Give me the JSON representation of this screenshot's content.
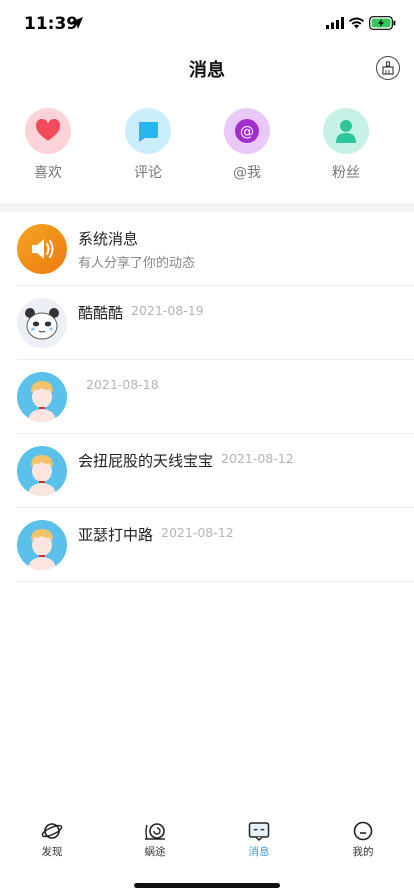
{
  "status_bar": {
    "time": "11:39"
  },
  "header": {
    "title": "消息"
  },
  "categories": [
    {
      "label": "喜欢",
      "icon": "heart-icon",
      "color": "#f24b5c"
    },
    {
      "label": "评论",
      "icon": "comment-icon",
      "color": "#27b6f0"
    },
    {
      "label": "@我",
      "icon": "at-icon",
      "color": "#a12fd0"
    },
    {
      "label": "粉丝",
      "icon": "fan-icon",
      "color": "#2ec79c"
    }
  ],
  "messages": [
    {
      "name": "系统消息",
      "subtitle": "有人分享了你的动态",
      "date": "",
      "avatar": "speaker-icon"
    },
    {
      "name": "酷酷酷",
      "subtitle": "",
      "date": "2021-08-19",
      "avatar": "panda-avatar"
    },
    {
      "name": "",
      "subtitle": "",
      "date": "2021-08-18",
      "avatar": "user-avatar"
    },
    {
      "name": "会扭屁股的天线宝宝",
      "subtitle": "",
      "date": "2021-08-12",
      "avatar": "user-avatar"
    },
    {
      "name": "亚瑟打中路",
      "subtitle": "",
      "date": "2021-08-12",
      "avatar": "user-avatar"
    }
  ],
  "tabs": [
    {
      "label": "发现",
      "icon": "planet-icon",
      "active": false
    },
    {
      "label": "蜗途",
      "icon": "snail-icon",
      "active": false
    },
    {
      "label": "消息",
      "icon": "message-icon",
      "active": true
    },
    {
      "label": "我的",
      "icon": "profile-icon",
      "active": false
    }
  ],
  "colors": {
    "accent": "#3a9ad9",
    "system_orange": "#f28c1a",
    "avatar_blue": "#5bc0ea"
  }
}
